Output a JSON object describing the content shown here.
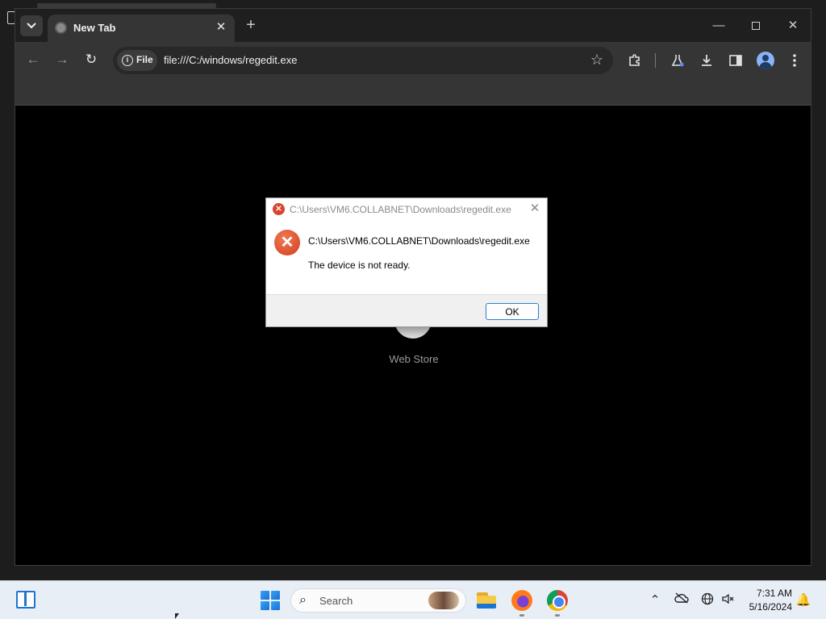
{
  "browser": {
    "tab": {
      "title": "New Tab",
      "favicon": "globe-icon",
      "close": "✕"
    },
    "new_tab": "+",
    "window_buttons": {
      "minimize": "—",
      "maximize": "",
      "close": "✕"
    },
    "toolbar": {
      "back": "←",
      "forward": "→",
      "reload": "↻",
      "site_info_label": "File",
      "url": "file:///C:/windows/regedit.exe",
      "bookmark_star": "☆",
      "icons": [
        "extensions-icon",
        "labs-icon",
        "download-icon",
        "side-panel-icon",
        "profile-icon",
        "menu-icon"
      ]
    },
    "content": {
      "shortcut_label": "Web Store"
    }
  },
  "dialog": {
    "title": "C:\\Users\\VM6.COLLABNET\\Downloads\\regedit.exe",
    "close": "✕",
    "path_text": "C:\\Users\\VM6.COLLABNET\\Downloads\\regedit.exe",
    "message": "The device is not ready.",
    "ok_label": "OK",
    "icon": "error-icon",
    "accent": "#d9442d"
  },
  "taskbar": {
    "search_placeholder": "Search",
    "apps": [
      "file-explorer",
      "firefox",
      "chrome"
    ],
    "time": "7:31 AM",
    "date": "5/16/2024",
    "tray": {
      "chevron": "⌃",
      "notifications": "🔔"
    }
  }
}
